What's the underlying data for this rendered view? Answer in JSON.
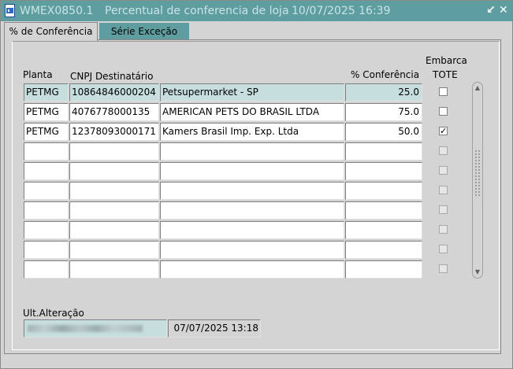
{
  "window": {
    "module": "WMEX0850.1",
    "title": "Percentual de conferencia de loja",
    "datetime": "10/07/2025 16:39",
    "colors": {
      "titlebar": "#5f9ea0",
      "selected_row": "#c7dede"
    }
  },
  "tabs": [
    {
      "label": "% de Conferência",
      "active": true
    },
    {
      "label": "Série Exceção",
      "active": false
    }
  ],
  "grid": {
    "headers": {
      "planta": "Planta",
      "cnpj": "CNPJ Destinatário",
      "conferencia": "% Conferência",
      "embarca_line1": "Embarca",
      "embarca_line2": "TOTE"
    },
    "rows": [
      {
        "planta": "PETMG",
        "cnpj": "10864846000204",
        "nome": "Petsupermarket - SP",
        "conferencia": "25.0",
        "tote": false
      },
      {
        "planta": "PETMG",
        "cnpj": "4076778000135",
        "nome": "AMERICAN PETS DO BRASIL LTDA",
        "conferencia": "75.0",
        "tote": false
      },
      {
        "planta": "PETMG",
        "cnpj": "12378093000171",
        "nome": "Kamers Brasil Imp. Exp. Ltda",
        "conferencia": "50.0",
        "tote": true
      }
    ],
    "empty_rows": 7,
    "selected_row": 0
  },
  "footer": {
    "label": "Ult.Alteração",
    "timestamp": "07/07/2025 13:18"
  },
  "icons": [
    "app-icon",
    "minimize-icon",
    "close-icon",
    "scroll-up-icon",
    "scroll-down-icon"
  ]
}
